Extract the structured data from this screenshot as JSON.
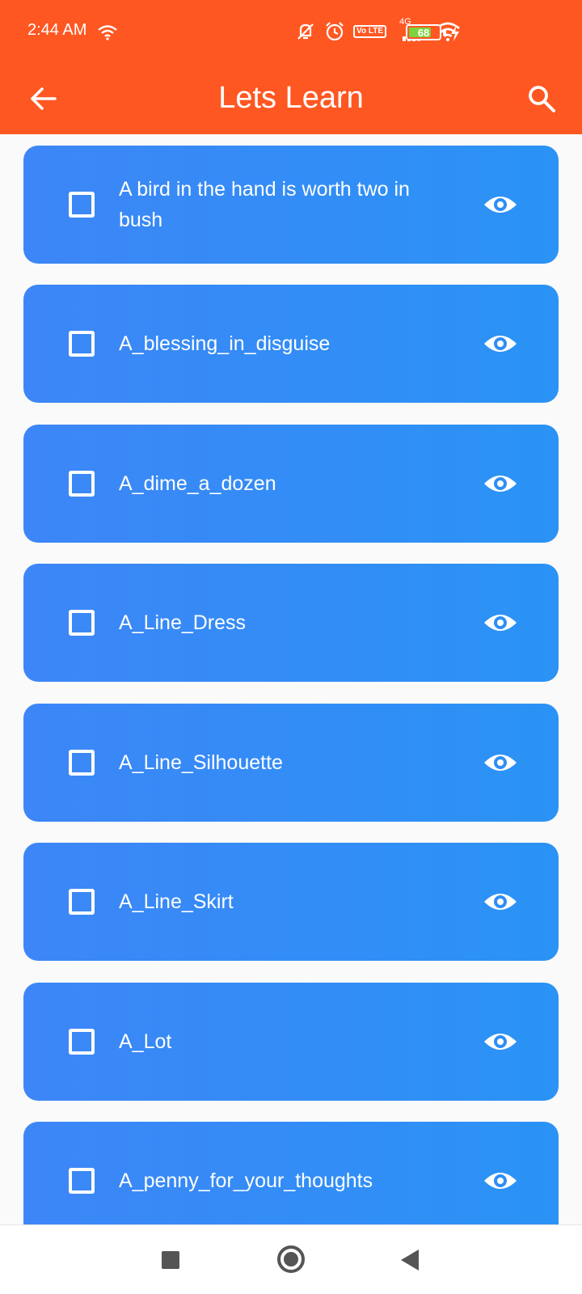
{
  "status_bar": {
    "time": "2:44 AM",
    "network_label": "4G",
    "volte_label": "Vo LTE",
    "battery_level": "68",
    "icons": [
      "wifi-small-icon",
      "mute-icon",
      "alarm-icon",
      "volte-icon",
      "signal-icon",
      "wifi-icon",
      "battery-icon",
      "charging-icon"
    ]
  },
  "app_bar": {
    "title": "Lets Learn",
    "back_icon": "arrow-left-icon",
    "search_icon": "search-icon",
    "background_color": "#ff5722"
  },
  "list": {
    "card_color_start": "#3d86f7",
    "card_color_end": "#2a93f5",
    "items": [
      {
        "label": "A bird in the hand is worth two in bush",
        "checked": false
      },
      {
        "label": "A_blessing_in_disguise",
        "checked": false
      },
      {
        "label": "A_dime_a_dozen",
        "checked": false
      },
      {
        "label": "A_Line_Dress",
        "checked": false
      },
      {
        "label": "A_Line_Silhouette",
        "checked": false
      },
      {
        "label": "A_Line_Skirt",
        "checked": false
      },
      {
        "label": "A_Lot",
        "checked": false
      },
      {
        "label": "A_penny_for_your_thoughts",
        "checked": false
      }
    ]
  },
  "nav_bar": {
    "icons": [
      "recents-square-icon",
      "home-circle-icon",
      "back-triangle-icon"
    ]
  }
}
